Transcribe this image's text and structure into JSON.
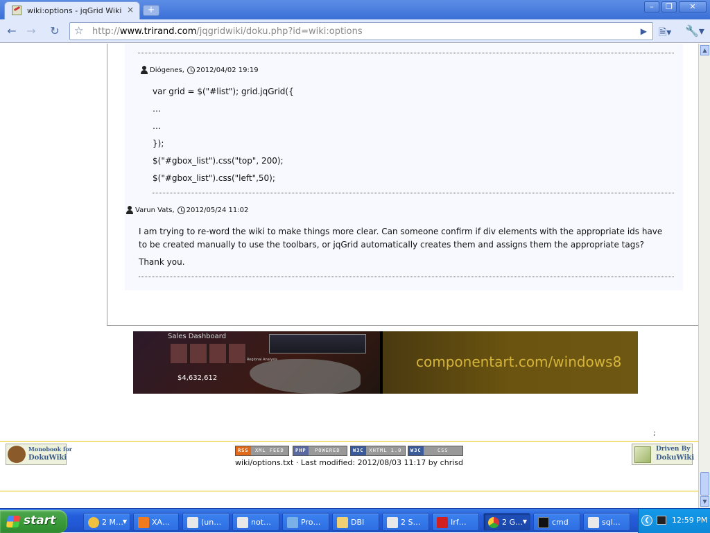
{
  "browser": {
    "tab_title": "wiki:options - jqGrid Wiki",
    "tab_close": "×",
    "new_tab": "+",
    "url_prefix": "http://",
    "url_host": "www.trirand.com",
    "url_path": "/jqgridwiki/doku.php?id=wiki:options",
    "window_buttons": {
      "minimize": "–",
      "maximize": "❐",
      "close": "✕"
    }
  },
  "comments": [
    {
      "author": "Diógenes,",
      "date": "2012/04/02 19:19",
      "code_lines": [
        "var grid = $(\"#list\"); grid.jqGrid({",
        "…",
        "…",
        "});",
        "$(\"#gbox_list\").css(\"top\", 200);",
        "$(\"#gbox_list\").css(\"left\",50);"
      ]
    },
    {
      "author": "Varun Vats,",
      "date": "2012/05/24 11:02",
      "paragraphs": [
        "I am trying to re-word the wiki to make things more clear. Can someone confirm if div elements with the appropriate ids have to be created manually to use the toolbars, or jqGrid automatically creates them and assigns them the appropriate tags?",
        "Thank you."
      ]
    }
  ],
  "banner": {
    "caption": "componentart.com/windows8",
    "dashboard_title": "Sales Dashboard",
    "total_value": "$4,632,612",
    "map_title": "Regional Analysis"
  },
  "footer": {
    "stray_text": ";",
    "logo_left_line1": "Monobook for",
    "logo_left_line2": "DokuWiki",
    "logo_right_line1": "Driven By",
    "logo_right_line2": "DokuWiki",
    "badges": [
      {
        "left": "RSS",
        "right": "XML FEED",
        "color": "#e06a1a"
      },
      {
        "left": "PHP",
        "right": "POWERED",
        "color": "#5a6aa0"
      },
      {
        "left": "W3C",
        "right": "XHTML 1.0",
        "color": "#3a5a9a"
      },
      {
        "left": "W3C",
        "right": "CSS",
        "color": "#3a5a9a"
      }
    ],
    "last_modified": "wiki/options.txt · Last modified: 2012/08/03 11:17 by chrisd"
  },
  "taskbar": {
    "start_label": "start",
    "tasks": [
      {
        "label": "2 M…",
        "icon_color": "#f0c040"
      },
      {
        "label": "XA…",
        "icon_color": "#f07a20"
      },
      {
        "label": "(un…",
        "icon_color": "#e8e8e8"
      },
      {
        "label": "not…",
        "icon_color": "#e8e8e8"
      },
      {
        "label": "Pro…",
        "icon_color": "#7ab0e8"
      },
      {
        "label": "DBI",
        "icon_color": "#f0d070"
      },
      {
        "label": "2 S…",
        "icon_color": "#e8e8e8"
      },
      {
        "label": "Irf…",
        "icon_color": "#d02020"
      },
      {
        "label": "2 G…",
        "icon_color": "#40a040"
      },
      {
        "label": "cmd",
        "icon_color": "#111111"
      },
      {
        "label": "sql…",
        "icon_color": "#e8e8e8"
      }
    ],
    "clock": "12:59 PM"
  }
}
